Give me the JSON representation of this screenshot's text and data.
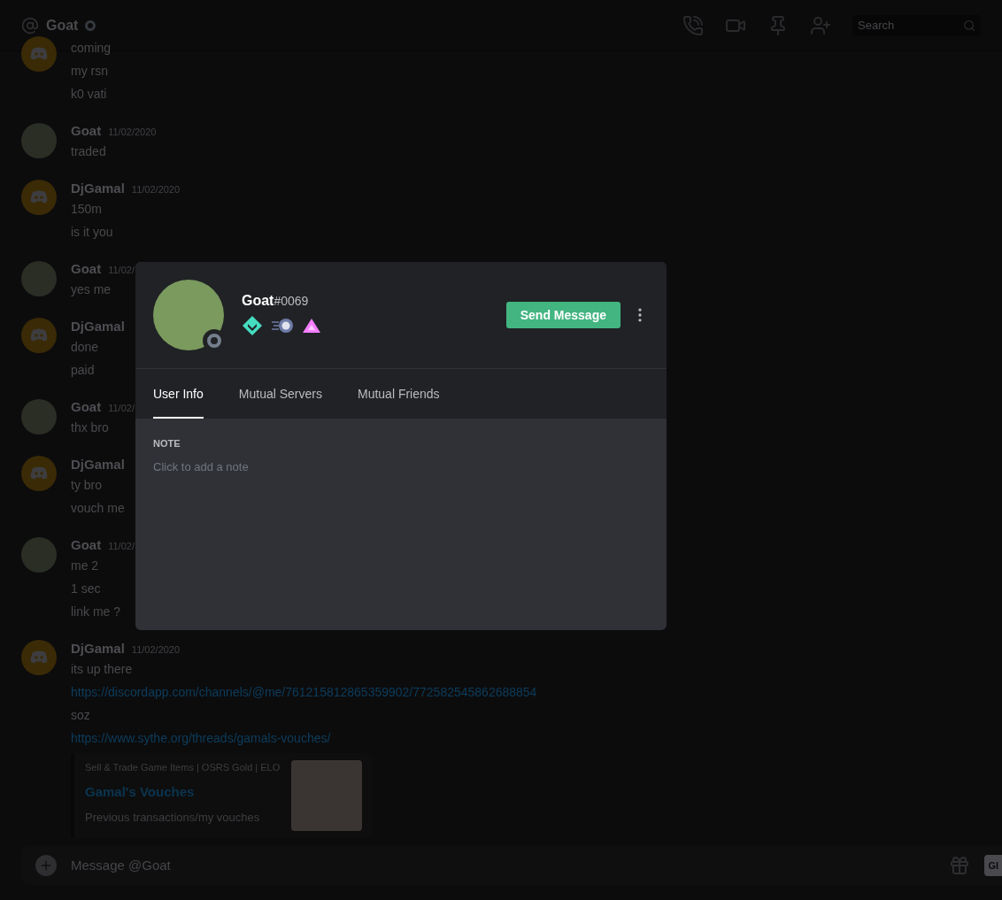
{
  "header": {
    "channel": "Goat",
    "online": false,
    "search": {
      "placeholder": "Search"
    }
  },
  "messages": [
    {
      "kind": "logo",
      "lines": [
        {
          "kind": "text",
          "text": "coming"
        },
        {
          "kind": "text",
          "text": "my rsn"
        },
        {
          "kind": "text",
          "text": "k0 vati"
        }
      ]
    },
    {
      "kind": "photo",
      "author": "Goat",
      "time": "11/02/2020",
      "lines": [
        {
          "kind": "text",
          "text": "traded"
        }
      ]
    },
    {
      "kind": "logo",
      "author": "DjGamal",
      "time": "11/02/2020",
      "lines": [
        {
          "kind": "text",
          "text": "150m"
        },
        {
          "kind": "text",
          "text": "is it you"
        }
      ]
    },
    {
      "kind": "photo",
      "author": "Goat",
      "time": "11/02/",
      "lines": [
        {
          "kind": "text",
          "text": "yes me"
        }
      ]
    },
    {
      "kind": "logo",
      "author": "DjGamal",
      "lines": [
        {
          "kind": "text",
          "text": "done"
        },
        {
          "kind": "text",
          "text": "paid"
        }
      ]
    },
    {
      "kind": "photo",
      "author": "Goat",
      "time": "11/02/",
      "lines": [
        {
          "kind": "text",
          "text": "thx bro"
        }
      ]
    },
    {
      "kind": "logo",
      "author": "DjGamal",
      "lines": [
        {
          "kind": "text",
          "text": "ty bro"
        },
        {
          "kind": "text",
          "text": "vouch me"
        }
      ]
    },
    {
      "kind": "photo",
      "author": "Goat",
      "time": "11/02/",
      "lines": [
        {
          "kind": "text",
          "text": "me 2"
        },
        {
          "kind": "text",
          "text": "1 sec"
        },
        {
          "kind": "text",
          "text": "link me ?"
        }
      ]
    },
    {
      "kind": "logo",
      "author": "DjGamal",
      "time": "11/02/2020",
      "lines": [
        {
          "kind": "text",
          "text": "its up there"
        },
        {
          "kind": "link",
          "text": "https://discordapp.com/channels/@me/761215812865359902/772582545862688854"
        },
        {
          "kind": "text",
          "text": "soz"
        },
        {
          "kind": "link",
          "text": "https://www.sythe.org/threads/gamals-vouches/"
        }
      ],
      "embed": {
        "provider": "Sell & Trade Game Items | OSRS Gold | ELO",
        "title": "Gamal's Vouches",
        "description": "Previous transactions/my vouches"
      }
    }
  ],
  "composer": {
    "placeholder": "Message @Goat",
    "gif_label": "GI"
  },
  "profile": {
    "username": "Goat",
    "discriminator": "#0069",
    "online": false,
    "action": "Send Message",
    "tabs": [
      {
        "label": "User Info",
        "selected": true
      },
      {
        "label": "Mutual Servers",
        "selected": false
      },
      {
        "label": "Mutual Friends",
        "selected": false
      }
    ],
    "note": {
      "heading": "NOTE",
      "placeholder": "Click to add a note"
    }
  }
}
